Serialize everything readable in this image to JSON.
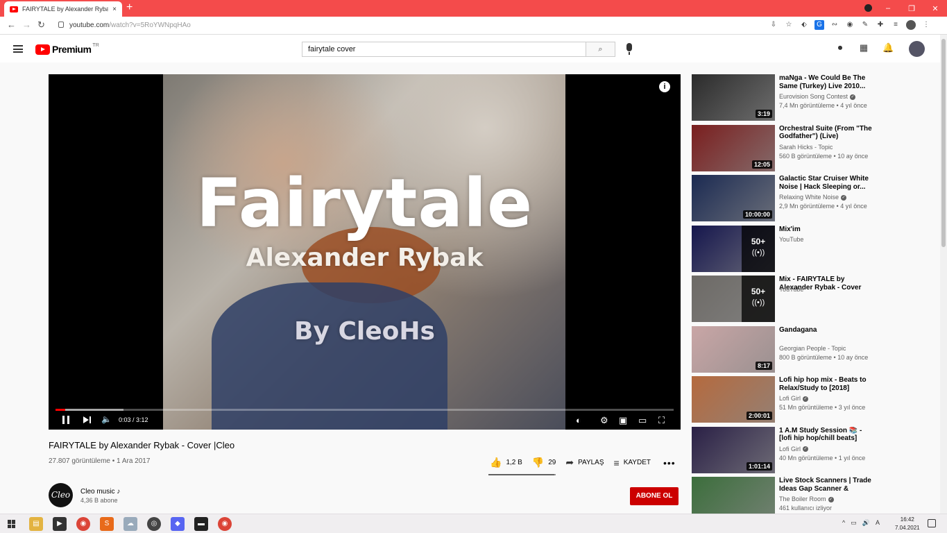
{
  "browser": {
    "tab_title": "FAIRYTALE by Alexander Rybak",
    "tab_close": "×",
    "new_tab": "+",
    "url_host": "youtube.com",
    "url_path": "/watch?v=5RoYWNpqHAo",
    "window_controls": [
      "–",
      "❐",
      "✕"
    ]
  },
  "youtube": {
    "logo_text": "Premium",
    "logo_country": "TR",
    "search_value": "fairytale cover",
    "search_button_icon": "⌕"
  },
  "player": {
    "overlay_title": "Fairytale",
    "overlay_artist": "Alexander Rybak",
    "overlay_by": "By CleoHs",
    "info_icon": "i",
    "time": "0:03 / 3:12",
    "progress_fraction": 0.016,
    "buffered_fraction": 0.11,
    "volume_icon": "🔈"
  },
  "video": {
    "title": "FAIRYTALE by Alexander Rybak - Cover |Cleo",
    "views": "27.807 görüntüleme",
    "date": "1 Ara 2017",
    "meta_sep": " • ",
    "likes": "1,2 B",
    "dislikes": "29",
    "like_ratio": 0.976,
    "share_label": "PAYLAŞ",
    "save_label": "KAYDET",
    "more": "•••"
  },
  "channel": {
    "avatar_text": "Cleo",
    "name": "Cleo music ♪",
    "subs": "4,36 B abone",
    "subscribe_label": "ABONE OL"
  },
  "sidebar": [
    {
      "title": "maNga - We Could Be The Same (Turkey) Live 2010...",
      "channel": "Eurovision Song Contest",
      "verified": true,
      "views": "7,4 Mn görüntüleme • 4 yıl önce",
      "duration": "3:19",
      "thumb_bg": "#2b2b2b"
    },
    {
      "title": "Orchestral Suite (From \"The Godfather\") (Live)",
      "channel": "Sarah Hicks - Topic",
      "verified": false,
      "views": "560 B görüntüleme • 10 ay önce",
      "duration": "12:05",
      "thumb_bg": "#7a1e1e"
    },
    {
      "title": "Galactic Star Cruiser White Noise | Hack Sleeping or...",
      "channel": "Relaxing White Noise",
      "verified": true,
      "views": "2,9 Mn görüntüleme • 4 yıl önce",
      "duration": "10:00:00",
      "thumb_bg": "#1b2a52"
    },
    {
      "title": "Mix'im",
      "channel": "YouTube",
      "verified": false,
      "views": "",
      "mix_count": "50+",
      "mix_icon": "((•))",
      "thumb_bg": "#15164d"
    },
    {
      "title": "Mix - FAIRYTALE by Alexander Rybak - Cover |Cleo",
      "channel": "YouTube",
      "verified": false,
      "views": "",
      "mix_count": "50+",
      "mix_icon": "((•))",
      "thumb_bg": "#6d6a66"
    },
    {
      "title": "Gandagana",
      "channel": "Georgian People - Topic",
      "verified": false,
      "views": "800 B görüntüleme • 10 ay önce",
      "duration": "8:17",
      "thumb_bg": "#c9a6a6"
    },
    {
      "title": "Lofi hip hop mix - Beats to Relax/Study to [2018]",
      "channel": "Lofi Girl",
      "verified": true,
      "views": "51 Mn görüntüleme • 3 yıl önce",
      "duration": "2:00:01",
      "thumb_bg": "#b56a3e"
    },
    {
      "title": "1 A.M Study Session 📚 - [lofi hip hop/chill beats]",
      "channel": "Lofi Girl",
      "verified": true,
      "views": "40 Mn görüntüleme • 1 yıl önce",
      "duration": "1:01:14",
      "thumb_bg": "#2a2046"
    },
    {
      "title": "Live Stock Scanners | Trade Ideas Gap Scanner & Penny...",
      "channel": "The Boiler Room",
      "verified": true,
      "views": "461 kullanıcı izliyor",
      "duration": "",
      "thumb_bg": "#3c6e3c"
    }
  ],
  "taskbar": {
    "clock_time": "16:42",
    "clock_date": "7.04.2021",
    "tray_icons": [
      "^",
      "▭",
      "🔊",
      "A"
    ]
  }
}
